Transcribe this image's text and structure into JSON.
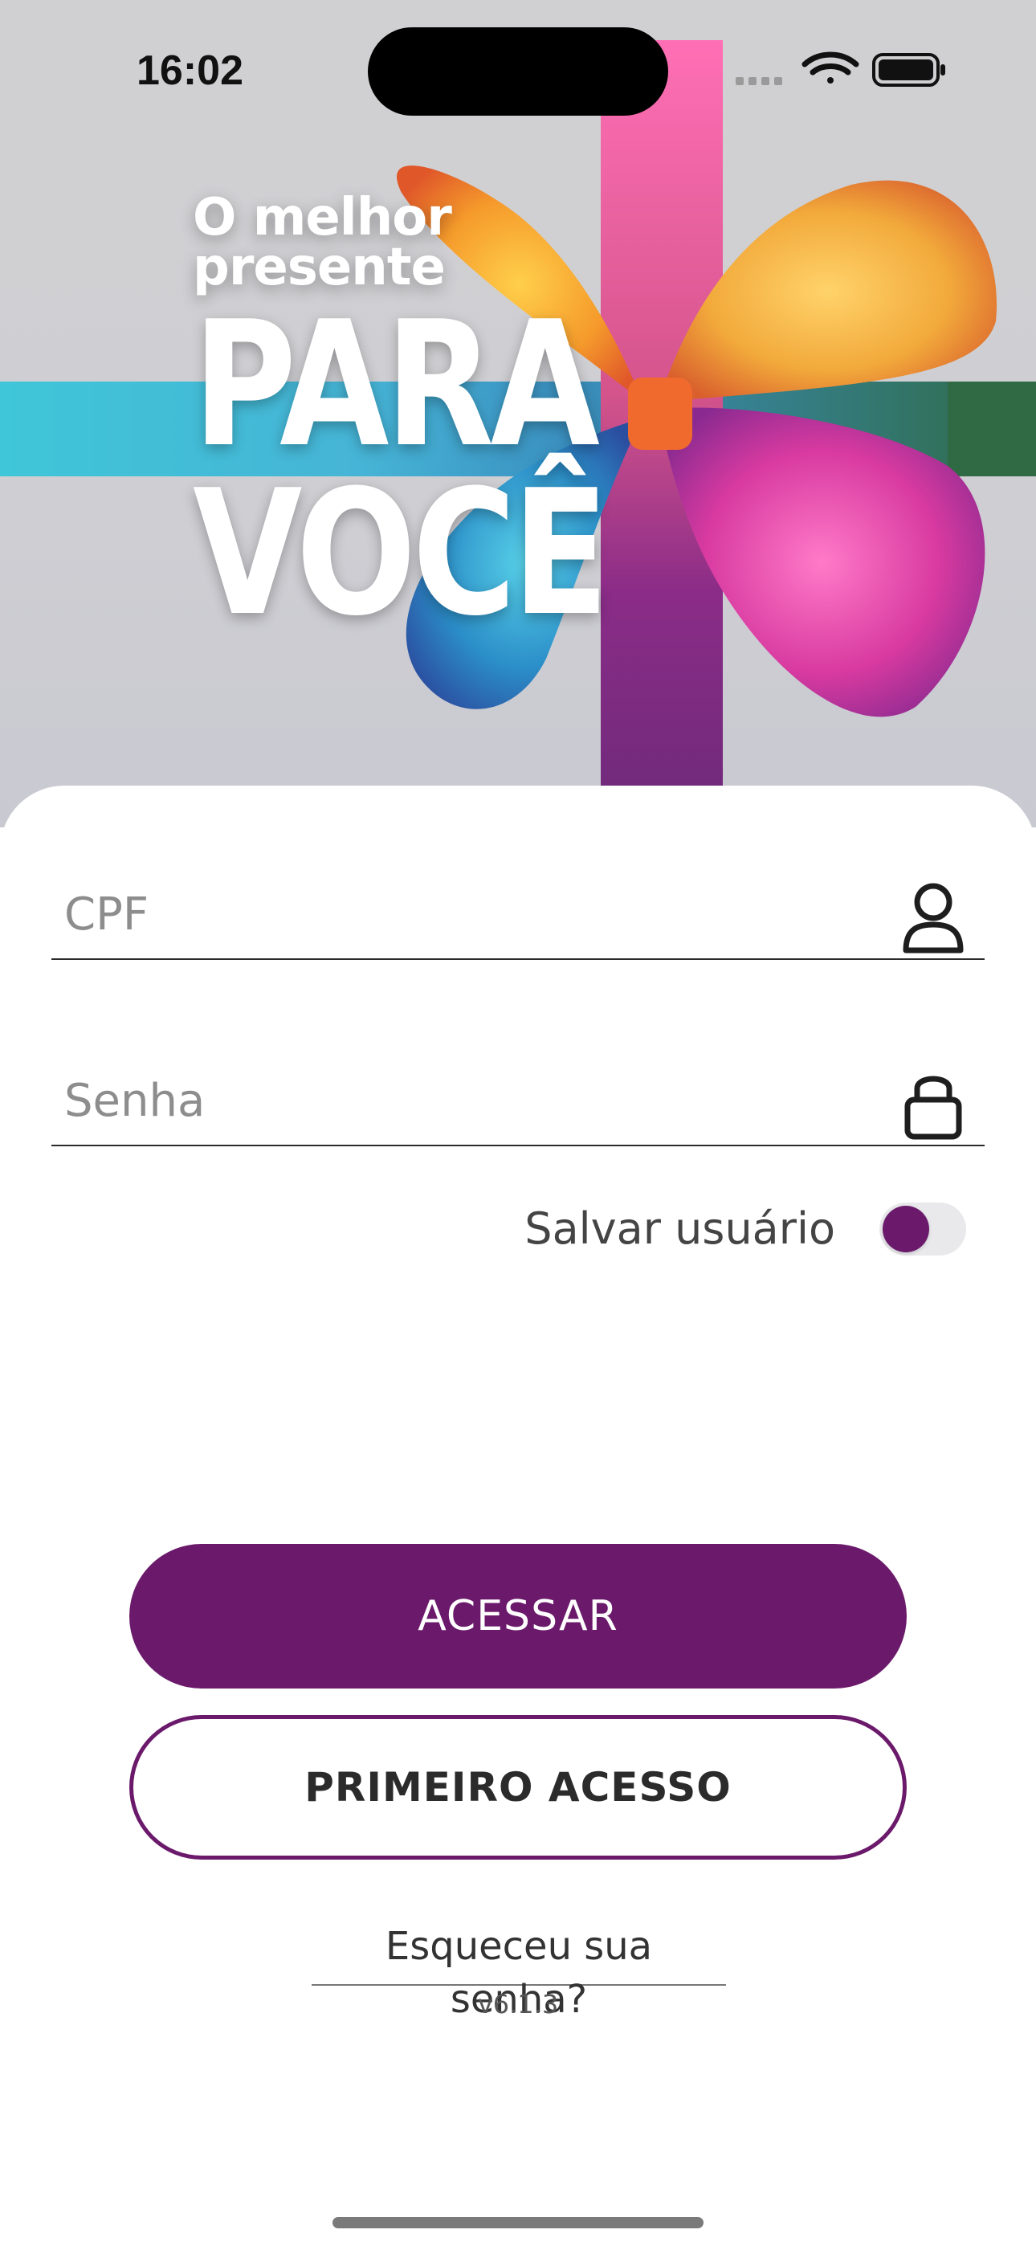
{
  "status_bar": {
    "time": "16:02",
    "icons": [
      "signal-icon",
      "wifi-icon",
      "battery-icon"
    ]
  },
  "banner": {
    "line1": "O melhor",
    "line2": "presente",
    "big1": "PARA",
    "big2": "VOCÊ"
  },
  "form": {
    "cpf": {
      "placeholder": "CPF",
      "value": "",
      "icon": "user-icon"
    },
    "senha": {
      "placeholder": "Senha",
      "value": "",
      "icon": "lock-icon"
    },
    "save_user": {
      "label": "Salvar usuário",
      "on": false
    }
  },
  "actions": {
    "primary_label": "ACESSAR",
    "secondary_label": "PRIMEIRO ACESSO",
    "forgot_label": "Esqueceu sua senha?"
  },
  "footer": {
    "version": "v6.1.3"
  },
  "colors": {
    "brand": "#6B1A6B",
    "toggle_track": "#E9E9EC",
    "banner_bg": "#D0D0D2"
  }
}
